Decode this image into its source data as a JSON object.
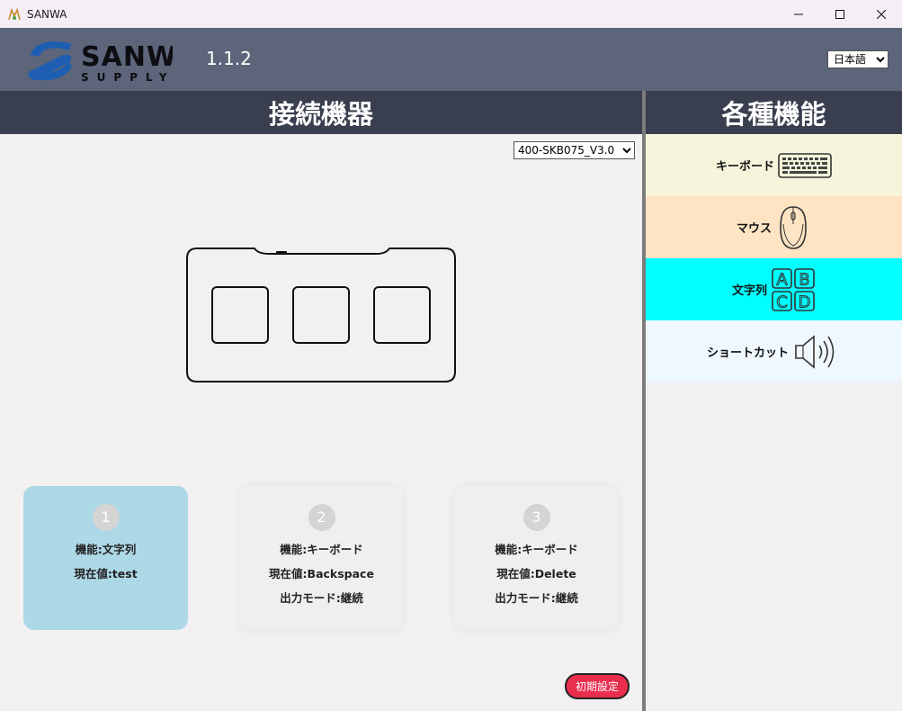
{
  "window": {
    "title": "SANWA"
  },
  "header": {
    "version": "1.1.2",
    "language_selected": "日本語"
  },
  "sections": {
    "devices": "接続機器",
    "functions": "各種機能"
  },
  "device": {
    "model_selected": "400-SKB075_V3.0"
  },
  "keys": [
    {
      "number": "1",
      "function": "機能:文字列",
      "current": "現在値:test",
      "mode": ""
    },
    {
      "number": "2",
      "function": "機能:キーボード",
      "current": "現在値:Backspace",
      "mode": "出力モード:継続"
    },
    {
      "number": "3",
      "function": "機能:キーボード",
      "current": "現在値:Delete",
      "mode": "出力モード:継続"
    }
  ],
  "functions": [
    {
      "label": "キーボード",
      "icon": "keyboard-icon",
      "color": "#f5f5dc"
    },
    {
      "label": "マウス",
      "icon": "mouse-icon",
      "color": "#ffe4c4"
    },
    {
      "label": "文字列",
      "icon": "abcd-icon",
      "color": "#00ffff"
    },
    {
      "label": "ショートカット",
      "icon": "speaker-icon",
      "color": "#f0f8ff"
    }
  ],
  "logo": {
    "line1": "SANWA",
    "line2": "SUPPLY"
  },
  "buttons": {
    "reset": "初期設定"
  },
  "colors": {
    "header": "#5c6579",
    "section_head": "#3a3f4f",
    "active_key": "#add8e6",
    "reset": "#ea2e4e"
  }
}
